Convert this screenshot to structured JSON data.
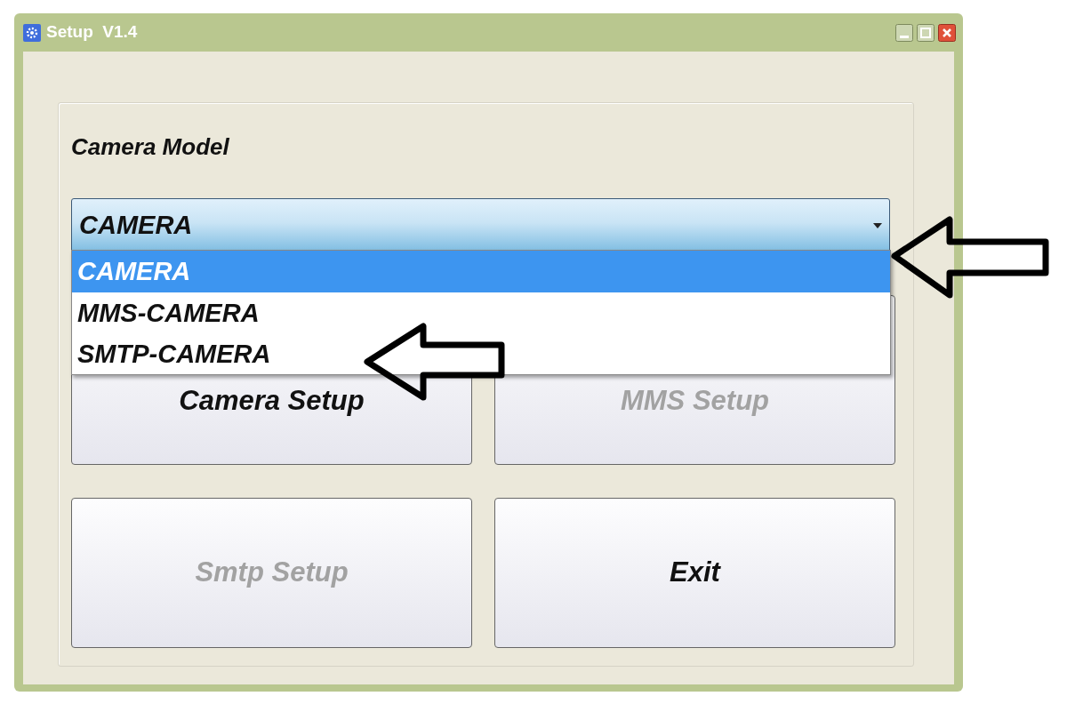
{
  "window": {
    "title": "Setup  V1.4"
  },
  "group": {
    "label": "Camera Model"
  },
  "combo": {
    "value": "CAMERA",
    "expanded": true,
    "options": [
      {
        "label": "CAMERA",
        "selected": true
      },
      {
        "label": "MMS-CAMERA",
        "selected": false
      },
      {
        "label": "SMTP-CAMERA",
        "selected": false
      }
    ]
  },
  "buttons": [
    {
      "label": "Camera Setup",
      "disabled": false
    },
    {
      "label": "MMS Setup",
      "disabled": true
    },
    {
      "label": "Smtp Setup",
      "disabled": true
    },
    {
      "label": "Exit",
      "disabled": false
    }
  ]
}
